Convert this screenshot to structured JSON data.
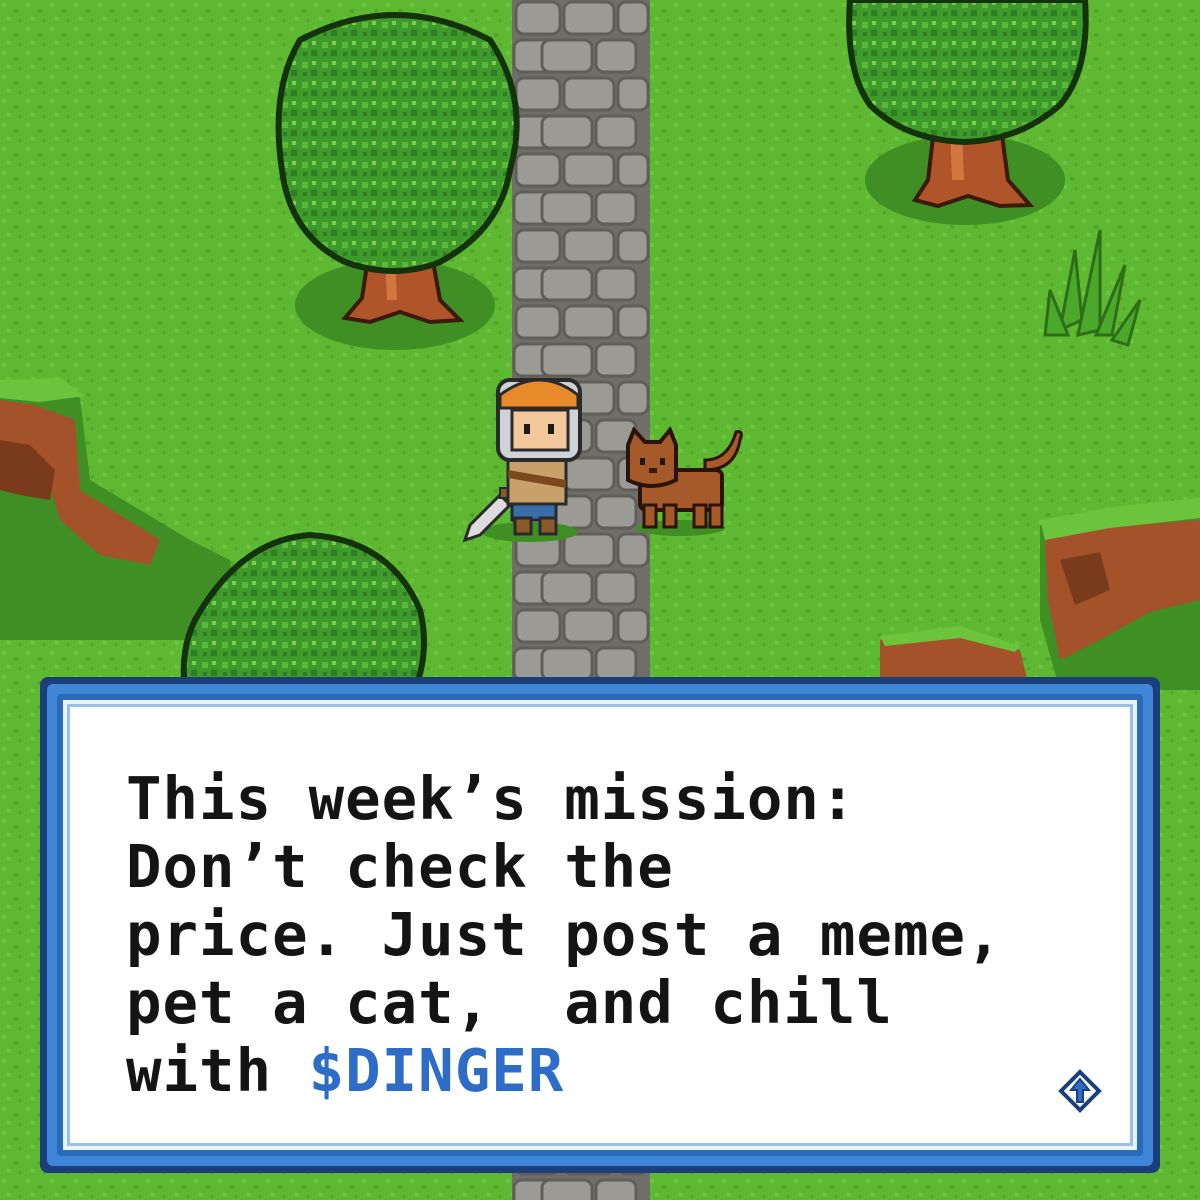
{
  "scene": {
    "colors": {
      "grass": "#5fb832",
      "grass_dark": "#3f8f24",
      "path_stone": "#9b9a94",
      "path_mortar": "#6f6e68",
      "tree_leaves": "#3f9a2c",
      "tree_trunk": "#b0542a",
      "cliff_dirt": "#a4522a",
      "cat_fur": "#a65a2a"
    },
    "sprites": [
      "oak-tree",
      "oak-tree",
      "oak-tree",
      "grass-tuft",
      "knight-hero",
      "brown-cat",
      "cobblestone-path",
      "dirt-cliff",
      "dirt-cliff"
    ]
  },
  "dialog": {
    "lines": [
      "This week’s mission:",
      "Don’t check the",
      "price. Just post a meme,",
      "pet a cat,  and chill"
    ],
    "last_line_prefix": "with ",
    "ticker": "$DINGER",
    "ticker_color": "#2d6cc7",
    "continue_icon": "advance-arrow-icon"
  }
}
